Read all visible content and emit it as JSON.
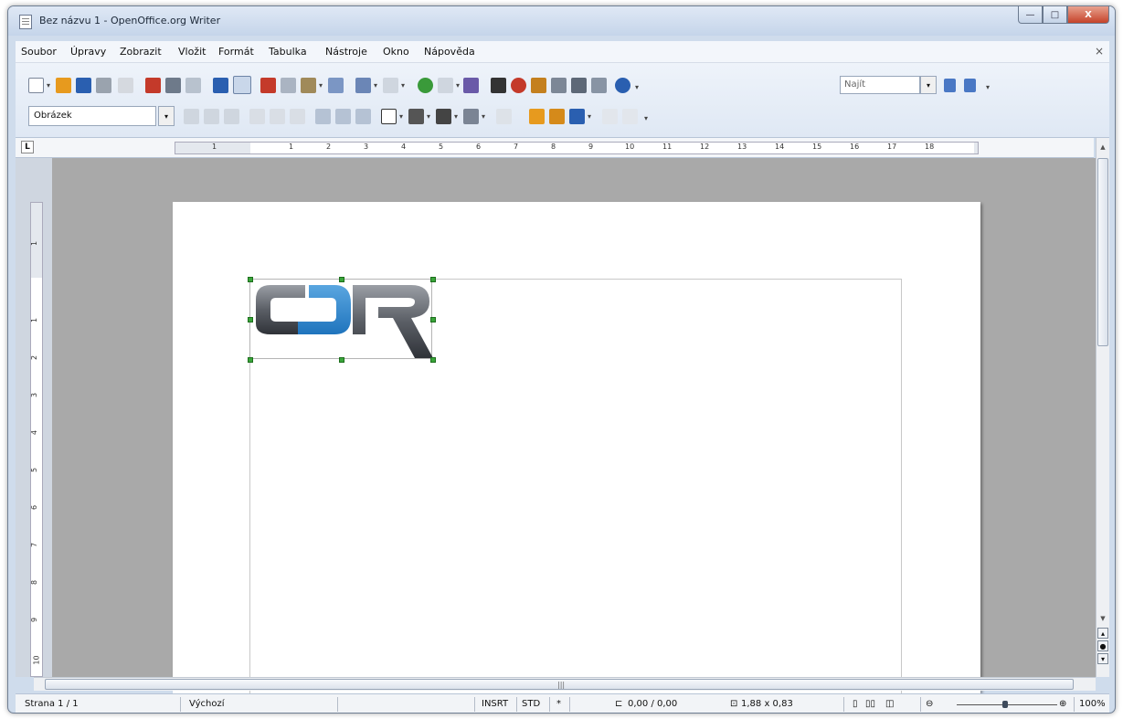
{
  "window": {
    "title": "Bez názvu 1 - OpenOffice.org Writer",
    "buttons": {
      "minimize": "—",
      "maximize": "□",
      "close": "X"
    }
  },
  "menu": {
    "items": [
      {
        "label": "Soubor"
      },
      {
        "label": "Úpravy"
      },
      {
        "label": "Zobrazit"
      },
      {
        "label": "Vložit"
      },
      {
        "label": "Formát"
      },
      {
        "label": "Tabulka"
      },
      {
        "label": "Nástroje"
      },
      {
        "label": "Okno"
      },
      {
        "label": "Nápověda"
      }
    ],
    "close_label": "×"
  },
  "toolbar": {
    "find_placeholder": "Najít",
    "style_value": "Obrázek",
    "colors": {
      "blue": "#2a5fb0",
      "red": "#c43a2a",
      "orange": "#e79a1e",
      "green": "#3a9a3a",
      "gray": "#9aa3ae"
    }
  },
  "ruler": {
    "corner_label": "L",
    "h_marks": [
      "1",
      "1",
      "2",
      "3",
      "4",
      "5",
      "6",
      "7",
      "8",
      "9",
      "10",
      "11",
      "12",
      "13",
      "14",
      "15",
      "16",
      "17",
      "18"
    ],
    "v_marks": [
      "1",
      "1",
      "2",
      "3",
      "4",
      "5",
      "6",
      "7",
      "8",
      "9",
      "10"
    ]
  },
  "document": {
    "logo_text": "CDR",
    "logo_colors": {
      "gray": "#5b5f66",
      "blue": "#1f74bd"
    },
    "selection_color": "#3aa53a"
  },
  "statusbar": {
    "page": "Strana 1 / 1",
    "style": "Výchozí",
    "insert_mode": "INSRT",
    "selection_mode": "STD",
    "modified": "*",
    "position": "0,00 / 0,00",
    "size": "1,88 x 0,83",
    "zoom": "100%"
  }
}
